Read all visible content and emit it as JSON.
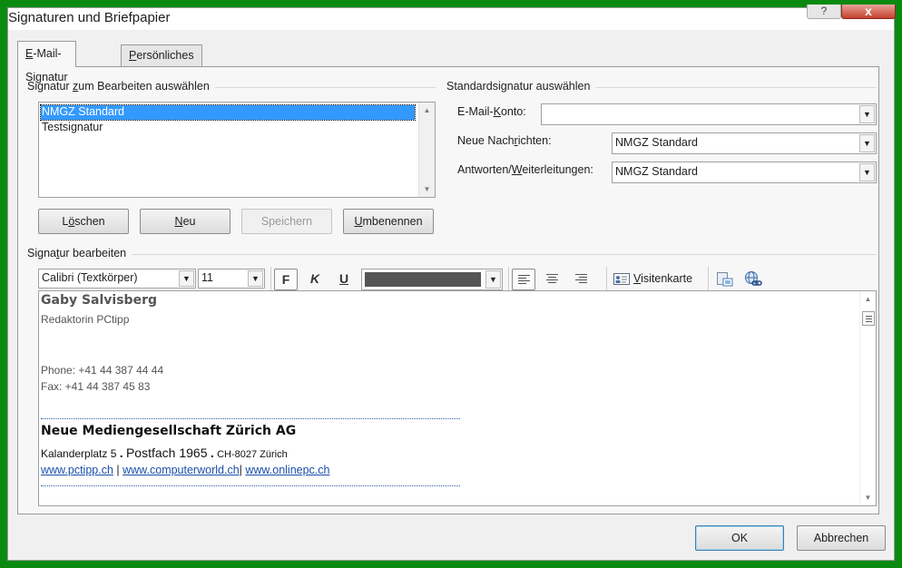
{
  "window": {
    "title": "Signaturen und Briefpapier",
    "help_glyph": "?",
    "close_glyph": "x"
  },
  "tabs": [
    {
      "label_pre": "",
      "label_u": "E",
      "label_post": "-Mail-Signatur",
      "active": true
    },
    {
      "label_pre": "",
      "label_u": "P",
      "label_post": "ersönliches Briefpapier",
      "active": false
    }
  ],
  "edit_section": {
    "label": "Signatur zum Bearbeiten auswählen",
    "label_pre": "Signatur ",
    "label_u": "z",
    "label_post": "um Bearbeiten auswählen"
  },
  "signatures": [
    {
      "name": "NMGZ Standard",
      "selected": true
    },
    {
      "name": "Testsignatur",
      "selected": false
    }
  ],
  "buttons": {
    "delete": {
      "pre": "L",
      "u": "ö",
      "post": "schen"
    },
    "new": {
      "pre": "",
      "u": "N",
      "post": "eu"
    },
    "save": {
      "label": "Speichern"
    },
    "rename": {
      "pre": "",
      "u": "U",
      "post": "mbenennen"
    }
  },
  "default_section": {
    "title": "Standardsignatur auswählen",
    "account_label_pre": "E-Mail-",
    "account_label_u": "K",
    "account_label_post": "onto:",
    "account_value": "",
    "new_msgs_label_pre": "Neue Nach",
    "new_msgs_label_u": "r",
    "new_msgs_label_post": "ichten:",
    "new_msgs_value": "NMGZ Standard",
    "replies_label_pre": "Antworten/",
    "replies_label_u": "W",
    "replies_label_post": "eiterleitungen:",
    "replies_value": "NMGZ Standard"
  },
  "editor_section": {
    "label_pre": "Signa",
    "label_u": "t",
    "label_post": "ur bearbeiten"
  },
  "toolbar": {
    "font": "Calibri (Textkörper)",
    "size": "11",
    "bold": "F",
    "italic": "K",
    "underline": "U",
    "color_swatch": "#555555",
    "business_card_pre": "",
    "business_card_u": "V",
    "business_card_post": "isitenkarte"
  },
  "signature_content": {
    "name": "Gaby Salvisberg",
    "role": "Redaktorin PCtipp",
    "phone": "Phone: +41 44 387 44 44",
    "fax": "Fax: +41 44 387 45 83",
    "company": "Neue Mediengesellschaft Zürich AG",
    "street": "Kalanderplatz 5",
    "sep": ".",
    "postbox": "Postfach 1965",
    "city": "CH-8027 Zürich",
    "links": [
      "www.pctipp.ch",
      "www.computerworld.ch",
      "www.onlinepc.ch"
    ],
    "link_sep": "|"
  },
  "footer": {
    "ok": "OK",
    "cancel": "Abbrechen"
  }
}
